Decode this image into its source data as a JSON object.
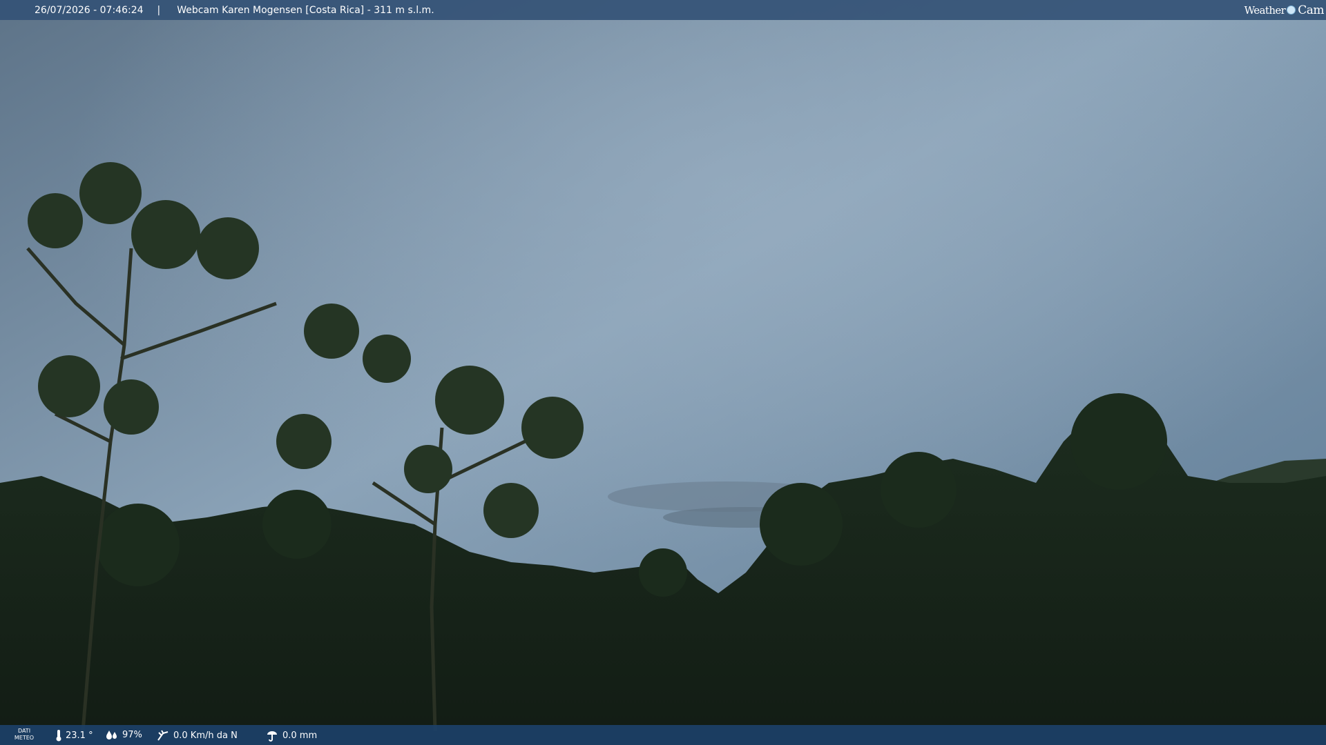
{
  "header": {
    "timestamp": "26/07/2026 - 07:46:24",
    "separator": "|",
    "title": "Webcam Karen Mogensen [Costa Rica]  - 311 m s.l.m."
  },
  "logo": {
    "word1": "Weather",
    "word2": "Cam"
  },
  "footer": {
    "label_line1": "DATI",
    "label_line2": "METEO",
    "temperature": "23.1 °",
    "humidity": "97%",
    "wind": "0.0 Km/h da N",
    "rain": "0.0 mm"
  },
  "icons": {
    "temperature": "thermometer-icon",
    "humidity": "humidity-icon",
    "wind": "wind-icon",
    "rain": "rain-gauge-icon"
  },
  "colors": {
    "header_bg": "#345276",
    "footer_bg": "#1c4068",
    "sky": "#8aa3b8",
    "foliage": "#1a2a1c"
  }
}
